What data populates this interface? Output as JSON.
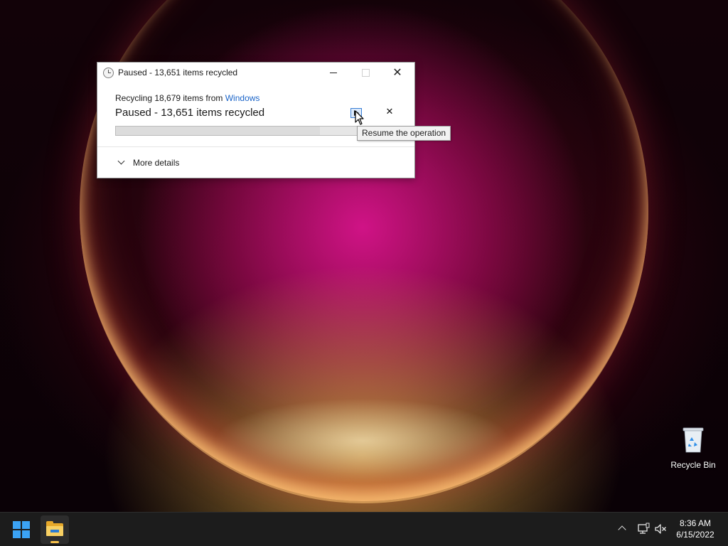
{
  "dialog": {
    "title": "Paused - 13,651 items recycled",
    "recycle_prefix": "Recycling 18,679 items from ",
    "source_link": "Windows",
    "status": "Paused - 13,651 items recycled",
    "progress_percent": 73,
    "more_details": "More details"
  },
  "tooltip": {
    "text": "Resume the operation"
  },
  "desktop": {
    "recycle_bin_label": "Recycle Bin"
  },
  "taskbar": {
    "time": "8:36 AM",
    "date": "6/15/2022"
  },
  "colors": {
    "accent": "#1a64c8",
    "start": "#3ba3f5"
  }
}
